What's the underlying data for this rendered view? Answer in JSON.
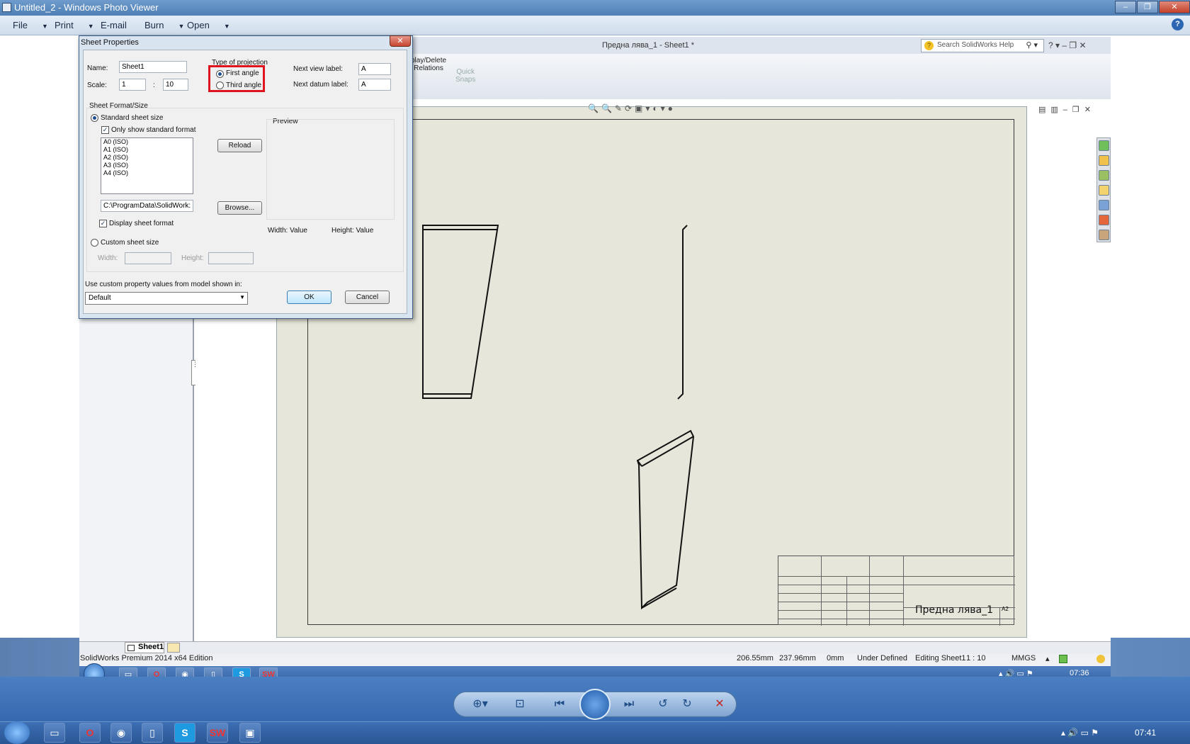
{
  "photo_viewer": {
    "title": "Untitled_2 - Windows Photo Viewer",
    "menu": {
      "file": "File",
      "print": "Print",
      "email": "E-mail",
      "burn": "Burn",
      "open": "Open"
    },
    "help": "?",
    "clock": "07:41"
  },
  "solidworks": {
    "doc_title": "Предна лява_1 - Sheet1 *",
    "search_placeholder": "Search SolidWorks Help",
    "ribbon": {
      "display_delete_relations": "play/Delete\nRelations",
      "quick_snaps": "Quick\nSnaps"
    },
    "sheet_tab": "Sheet1",
    "status": {
      "edition": "SolidWorks Premium 2014 x64 Edition",
      "x": "206.55mm",
      "y": "237.96mm",
      "z": "0mm",
      "state": "Under Defined",
      "editing": "Editing Sheet1",
      "scale": "1 : 10",
      "units": "MMGS"
    },
    "title_block": {
      "name": "Предна лява_1",
      "size": "A2"
    },
    "taskbar_clock": "07:36"
  },
  "dialog": {
    "title": "Sheet Properties",
    "name_label": "Name:",
    "name_value": "Sheet1",
    "scale_label": "Scale:",
    "scale_num": "1",
    "scale_sep": ":",
    "scale_den": "10",
    "projection_title": "Type of projection",
    "first_angle": "First angle",
    "third_angle": "Third angle",
    "next_view_label": "Next view label:",
    "next_view_value": "A",
    "next_datum_label": "Next datum label:",
    "next_datum_value": "A",
    "sheet_format_title": "Sheet Format/Size",
    "standard_size": "Standard sheet size",
    "only_standard": "Only show standard format",
    "formats": [
      "A0 (ISO)",
      "A1 (ISO)",
      "A2 (ISO)",
      "A3 (ISO)",
      "A4 (ISO)"
    ],
    "reload": "Reload",
    "path_value": "C:\\ProgramData\\SolidWork:",
    "browse": "Browse...",
    "display_format": "Display sheet format",
    "custom_size": "Custom sheet size",
    "width_label": "Width:",
    "height_label": "Height:",
    "preview_title": "Preview",
    "preview_width": "Width:  Value",
    "preview_height": "Height:  Value",
    "custom_prop_label": "Use custom property values from model shown in:",
    "combo_value": "Default",
    "ok": "OK",
    "cancel": "Cancel"
  }
}
